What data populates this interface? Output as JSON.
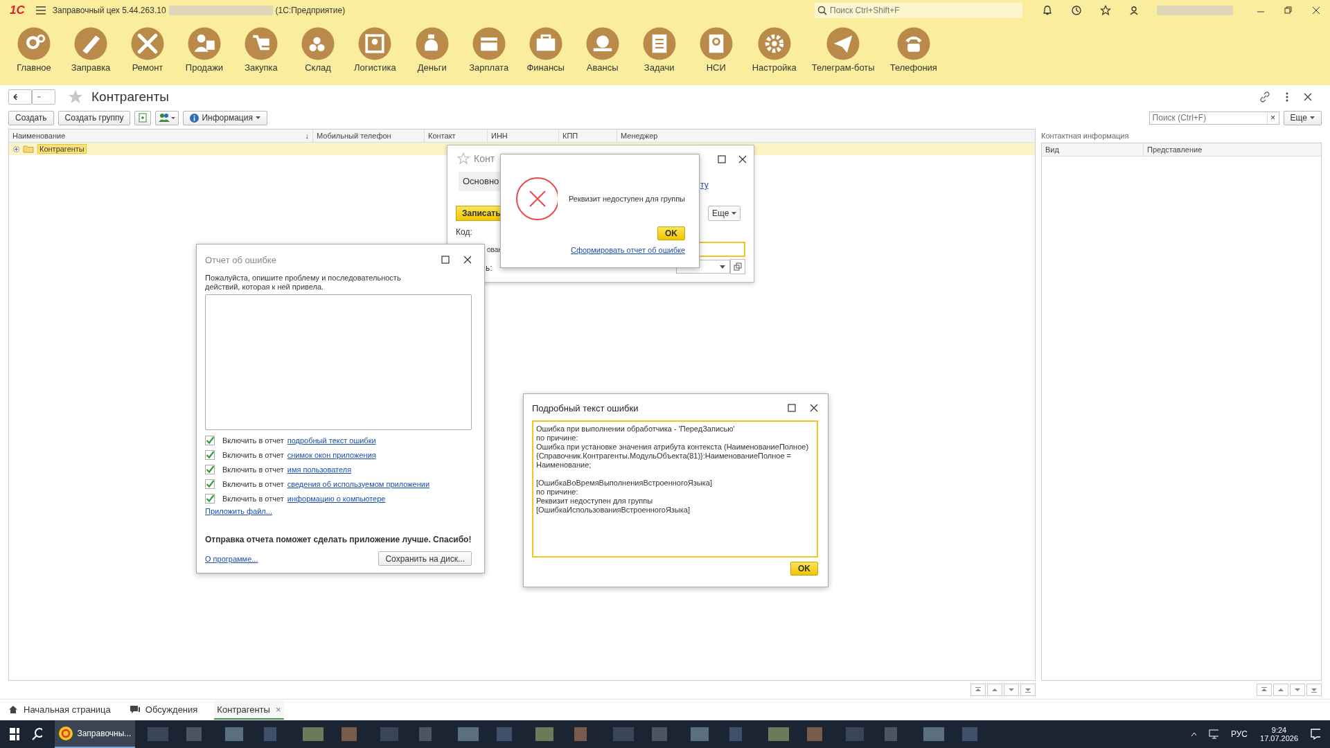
{
  "title_bar": {
    "logo": "1С",
    "title": "Заправочный цех 5.44.263.10",
    "title_suffix": "(1С:Предприятие)",
    "search_placeholder": "Поиск Ctrl+Shift+F"
  },
  "sections": [
    "Главное",
    "Заправка",
    "Ремонт",
    "Продажи",
    "Закупка",
    "Склад",
    "Логистика",
    "Деньги",
    "Зарплата",
    "Финансы",
    "Авансы",
    "Задачи",
    "НСИ",
    "Настройка",
    "Телеграм-боты",
    "Телефония"
  ],
  "page": {
    "title": "Контрагенты"
  },
  "toolbar": {
    "buttons": [
      "Создать",
      "Создать группу"
    ],
    "info_button": "Информация",
    "search_placeholder": "Поиск (Ctrl+F)",
    "clear": "×",
    "more_button": "Еще"
  },
  "table": {
    "columns": [
      "Наименование",
      "Мобильный телефон",
      "Контакт",
      "ИНН",
      "КПП",
      "Менеджер"
    ],
    "sort_mark": "↓",
    "rows": [
      {
        "name": "Контрагенты",
        "selected": true
      }
    ]
  },
  "contact_panel": {
    "title": "Контактная информация",
    "columns": [
      "Вид",
      "Представление"
    ]
  },
  "background_form": {
    "title": "Конт",
    "tab": "Основно",
    "link": "ту",
    "save_button": "Записать",
    "more_button": "Еще",
    "code_label": "Код:",
    "name_label": "ован",
    "field_label": "ь:"
  },
  "message_box": {
    "text": "Реквизит недоступен для группы",
    "ok": "OK",
    "link": "Сформировать отчет об ошибке"
  },
  "error_report": {
    "title": "Отчет об ошибке",
    "prompt": "Пожалуйста, опишите проблему и последовательность действий, которая к ней привела.",
    "options": [
      {
        "text": "Включить в отчет",
        "link": "подробный текст ошибки",
        "checked": true
      },
      {
        "text": "Включить в отчет",
        "link": "снимок окон приложения",
        "checked": true
      },
      {
        "text": "Включить в отчет",
        "link": "имя пользователя",
        "checked": true
      },
      {
        "text": "Включить в отчет",
        "link": "сведения об используемом приложении",
        "checked": true
      },
      {
        "text": "Включить в отчет",
        "link": "информацию о компьютере",
        "checked": true
      }
    ],
    "attach_link": "Приложить файл...",
    "thanks": "Отправка отчета поможет сделать приложение лучше. Спасибо!",
    "about_link": "О программе...",
    "save_button": "Сохранить на диск..."
  },
  "detail_dialog": {
    "title": "Подробный текст ошибки",
    "paragraphs": [
      [
        "Ошибка при выполнении обработчика - 'ПередЗаписью'",
        "по причине:",
        "Ошибка при установке значения атрибута контекста (НаименованиеПолное)",
        "{Справочник.Контрагенты.МодульОбъекта(81)}:НаименованиеПолное =",
        "Наименование;"
      ],
      [
        "[ОшибкаВоВремяВыполненияВстроенногоЯзыка]",
        "по причине:",
        "Реквизит недоступен для группы",
        "[ОшибкаИспользованияВстроенногоЯзыка]"
      ]
    ],
    "ok": "OK"
  },
  "open_tabs": [
    {
      "label": "Начальная страница",
      "selected": false
    },
    {
      "label": "Обсуждения",
      "selected": false
    },
    {
      "label": "Контрагенты",
      "selected": true,
      "close": "×"
    }
  ],
  "taskbar": {
    "app": "Заправочны...",
    "language": "РУС",
    "time": "9:24",
    "date": "17.07.2026"
  }
}
